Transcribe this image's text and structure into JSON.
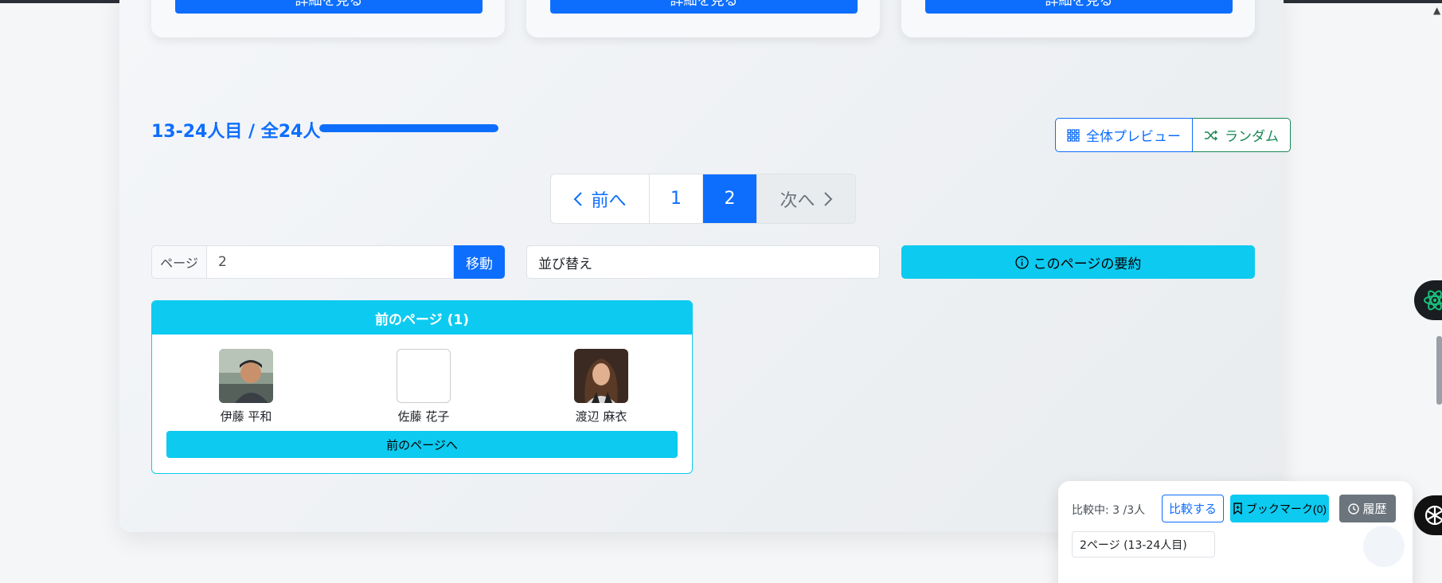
{
  "cards": [
    {
      "button_label": "詳細を見る"
    },
    {
      "button_label": "詳細を見る"
    },
    {
      "button_label": "詳細を見る"
    }
  ],
  "results": {
    "count_label": "13-24人目 / 全24人",
    "progress_fraction": 1.0
  },
  "view_buttons": {
    "preview_label": "全体プレビュー",
    "random_label": "ランダム"
  },
  "pagination": {
    "prev_label": "前へ",
    "pages": [
      "1",
      "2"
    ],
    "active_page": "2",
    "next_label": "次へ"
  },
  "page_jump": {
    "label": "ページ",
    "value": "2",
    "button_label": "移動"
  },
  "sort": {
    "selected": "並び替え"
  },
  "summary_button": {
    "label": "このページの要約"
  },
  "previous_page": {
    "header": "前のページ (1)",
    "people": [
      {
        "name": "伊藤 平和"
      },
      {
        "name": "佐藤 花子"
      },
      {
        "name": "渡辺 麻衣"
      }
    ],
    "button_label": "前のページへ"
  },
  "compare": {
    "status_label": "比較中: 3 /3人",
    "compare_button": "比較する",
    "bookmark_button": "ブックマーク(0)",
    "history_button": "履歴",
    "page_info": "2ページ (13-24人目)"
  },
  "icons": {
    "preview": "grid-icon",
    "random": "shuffle-icon",
    "prev": "chevron-left-icon",
    "next": "chevron-right-icon",
    "summary": "info-circle-icon",
    "bookmark": "bookmark-icon",
    "history": "clock-icon",
    "side_assistant": "atom-icon",
    "side_chat": "openai-icon"
  },
  "colors": {
    "primary": "#0d6efd",
    "info": "#0dcaf0",
    "success": "#198754",
    "secondary": "#6c757d"
  }
}
